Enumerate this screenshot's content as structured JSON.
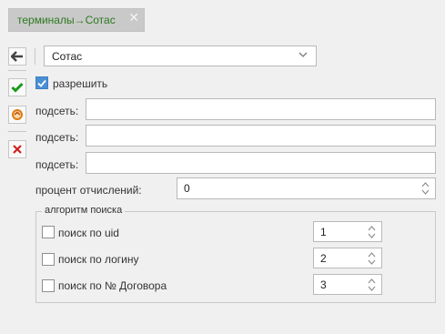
{
  "tab": {
    "label": "терминалы→Сотас",
    "close": "✕"
  },
  "toolbar": {
    "back_icon": "arrow-left-icon",
    "save_icon": "checkmark-icon",
    "refresh_icon": "refresh-icon",
    "delete_icon": "delete-icon"
  },
  "select": {
    "value": "Сотас"
  },
  "allow": {
    "label": "разрешить",
    "checked": true
  },
  "subnets": [
    {
      "label": "подсеть:",
      "value": ""
    },
    {
      "label": "подсеть:",
      "value": ""
    },
    {
      "label": "подсеть:",
      "value": ""
    }
  ],
  "deduction": {
    "label": "процент отчислений:",
    "value": "0"
  },
  "search": {
    "legend": "алгоритм поиска",
    "items": [
      {
        "label": "поиск по uid",
        "value": "1",
        "checked": false
      },
      {
        "label": "поиск по логину",
        "value": "2",
        "checked": false
      },
      {
        "label": "поиск по № Договора",
        "value": "3",
        "checked": false
      }
    ]
  },
  "colors": {
    "tab_text": "#2d7a1e",
    "check_accent": "#4a8fd4",
    "save_green": "#1a9a1a",
    "delete_red": "#d22020",
    "refresh_orange": "#e07a10"
  }
}
